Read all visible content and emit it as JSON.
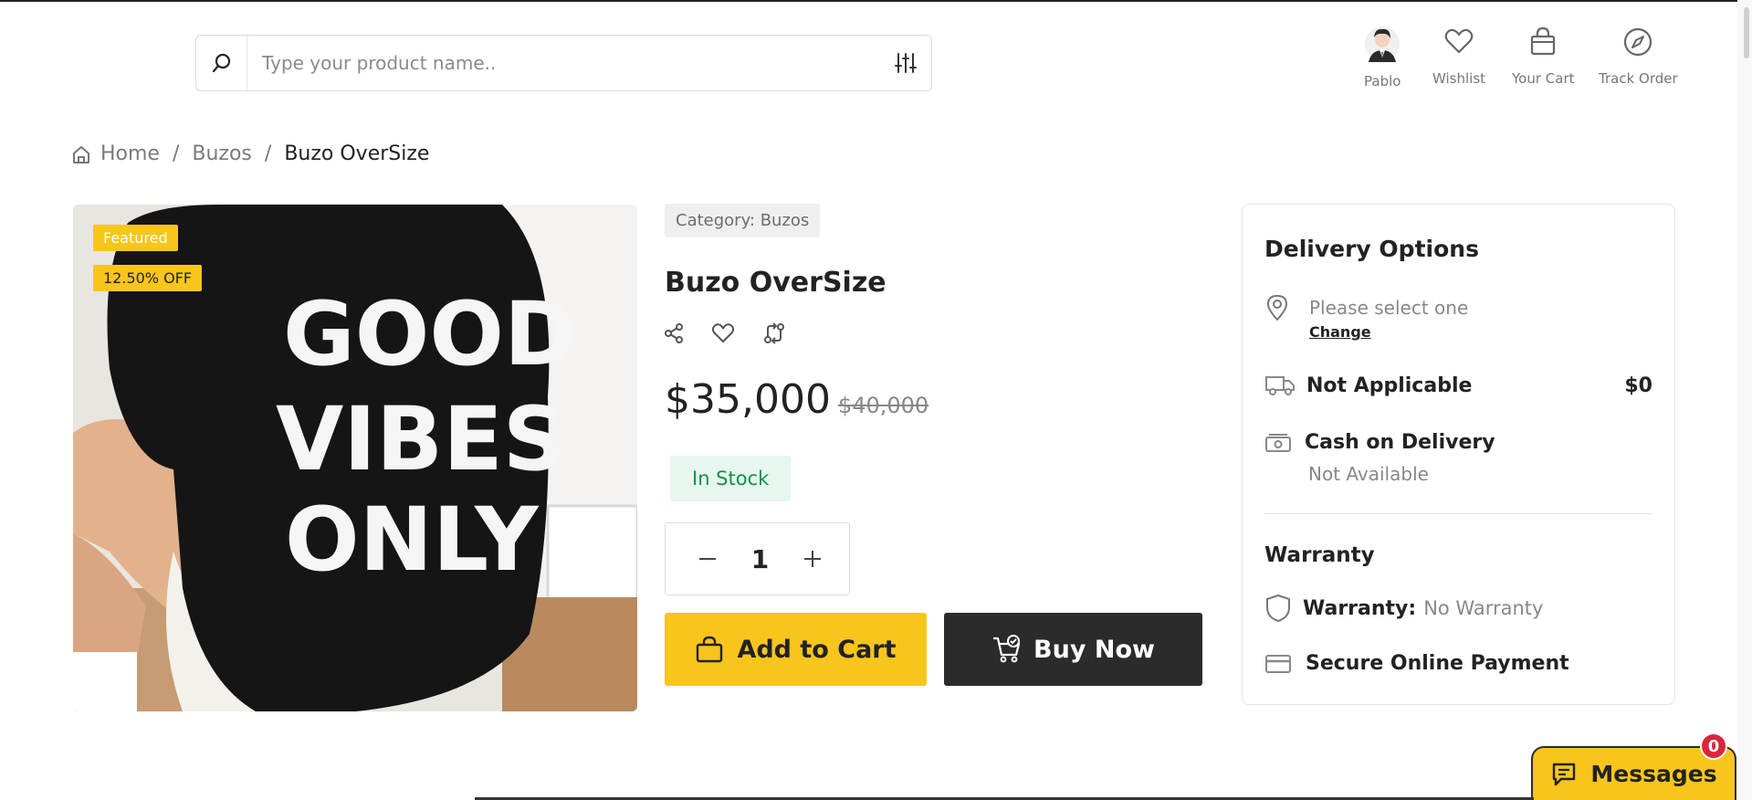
{
  "search": {
    "placeholder": "Type your product name.."
  },
  "header_nav": {
    "profile": "Pablo",
    "wishlist": "Wishlist",
    "cart": "Your Cart",
    "track": "Track Order"
  },
  "breadcrumb": {
    "home": "Home",
    "sep": "/",
    "category": "Buzos",
    "current": "Buzo OverSize"
  },
  "product": {
    "badges": {
      "featured": "Featured",
      "discount": "12.50% OFF"
    },
    "image_print": [
      "GOOD",
      "VIBES",
      "ONLY"
    ],
    "category": "Category: Buzos",
    "title": "Buzo OverSize",
    "price": "$35,000",
    "old_price": "$40,000",
    "stock": "In Stock",
    "quantity": "1",
    "add_to_cart": "Add to Cart",
    "buy_now": "Buy Now"
  },
  "delivery": {
    "heading": "Delivery Options",
    "location_text": "Please select one",
    "change": "Change",
    "shipping_label": "Not Applicable",
    "shipping_price": "$0",
    "cod_label": "Cash on Delivery",
    "cod_status": "Not Available",
    "warranty_heading": "Warranty",
    "warranty_label": "Warranty:",
    "warranty_value": "No Warranty",
    "secure_payment": "Secure Online Payment"
  },
  "messages": {
    "label": "Messages",
    "count": "0"
  },
  "colors": {
    "accent": "#f8c51c",
    "dark": "#2b2b2b",
    "stock_green": "#14924a",
    "stock_bg": "#e7f6ee"
  }
}
